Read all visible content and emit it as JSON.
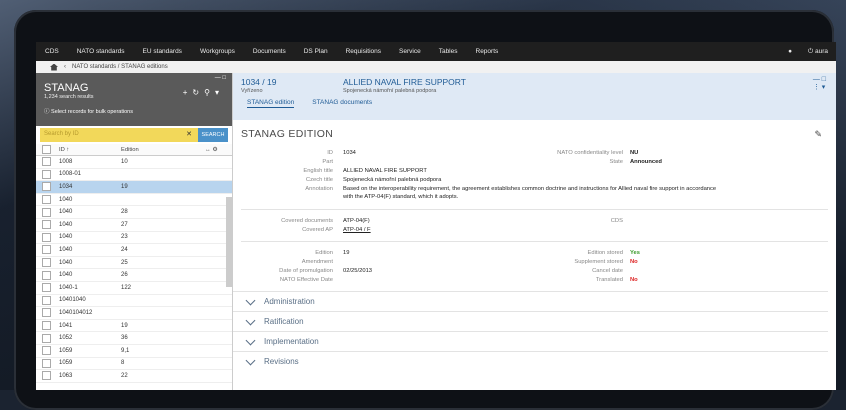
{
  "nav": {
    "items": [
      "CDS",
      "NATO standards",
      "EU standards",
      "Workgroups",
      "Documents",
      "DS Plan",
      "Requisitions",
      "Service",
      "Tables",
      "Reports"
    ],
    "user": "aura"
  },
  "breadcrumb": "NATO standards / STANAG editions",
  "left": {
    "title": "STANAG",
    "count": "1,234 search results",
    "bulk_hint": "Select records for bulk operations",
    "search_placeholder": "Search by ID",
    "search_button": "SEARCH",
    "col_id": "ID",
    "col_edition": "Edition",
    "rows": [
      {
        "id": "1008",
        "ed": "10"
      },
      {
        "id": "1008-01",
        "ed": ""
      },
      {
        "id": "1034",
        "ed": "19",
        "selected": true
      },
      {
        "id": "1040",
        "ed": ""
      },
      {
        "id": "1040",
        "ed": "28"
      },
      {
        "id": "1040",
        "ed": "27"
      },
      {
        "id": "1040",
        "ed": "23"
      },
      {
        "id": "1040",
        "ed": "24"
      },
      {
        "id": "1040",
        "ed": "25"
      },
      {
        "id": "1040",
        "ed": "26"
      },
      {
        "id": "1040-1",
        "ed": "122"
      },
      {
        "id": "10401040",
        "ed": ""
      },
      {
        "id": "1040104012",
        "ed": ""
      },
      {
        "id": "1041",
        "ed": "19"
      },
      {
        "id": "1052",
        "ed": "36"
      },
      {
        "id": "1059",
        "ed": "9,1"
      },
      {
        "id": "1059",
        "ed": "8"
      },
      {
        "id": "1063",
        "ed": "22"
      }
    ]
  },
  "detail": {
    "id": "1034 / 19",
    "status": "Vyřízeno",
    "title": "ALLIED NAVAL FIRE SUPPORT",
    "czech_title": "Spojenecká námořní palebná podpora",
    "tab1": "STANAG edition",
    "tab2": "STANAG documents",
    "section": "STANAG EDITION",
    "labels": {
      "id": "ID",
      "part": "Part",
      "english": "English title",
      "czech": "Czech title",
      "annotation": "Annotation",
      "conf": "NATO confidentiality level",
      "state": "State",
      "covered_docs": "Covered documents",
      "covered_ap": "Covered AP",
      "cds": "CDS",
      "edition": "Edition",
      "amendment": "Amendment",
      "promulgation": "Date of promulgation",
      "effective": "NATO Effective Date",
      "ed_stored": "Edition stored",
      "supp_stored": "Supplement stored",
      "cancel": "Cancel date",
      "translated": "Translated"
    },
    "values": {
      "id": "1034",
      "english": "ALLIED NAVAL FIRE SUPPORT",
      "czech": "Spojenecká námořní palebná podpora",
      "annotation1": "Based on the interoperability requirement, the agreement establishes common doctrine and instructions for Allied naval fire support in accordance",
      "annotation2": "with the ATP-04(F) standard, which it adopts.",
      "conf": "NU",
      "state": "Announced",
      "covered_docs": "ATP-04(F)",
      "covered_ap": "ATP-04 / F",
      "edition": "19",
      "promulgation": "02/25/2013",
      "ed_stored": "Yes",
      "supp_stored": "No",
      "translated": "No"
    },
    "accordions": [
      "Administration",
      "Ratification",
      "Implementation",
      "Revisions"
    ]
  }
}
